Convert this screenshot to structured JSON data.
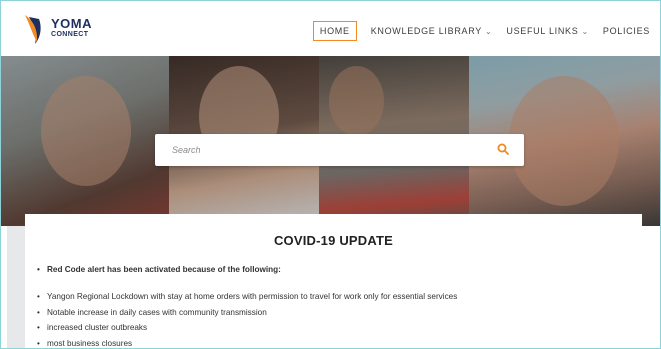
{
  "header": {
    "logo": {
      "word": "YOMA",
      "sub": "CONNECT",
      "colors": {
        "orange": "#f08a24",
        "navy": "#1d2f5f"
      }
    },
    "nav": [
      {
        "label": "HOME",
        "active": true,
        "dropdown": false
      },
      {
        "label": "KNOWLEDGE LIBRARY",
        "active": false,
        "dropdown": true
      },
      {
        "label": "USEFUL LINKS",
        "active": false,
        "dropdown": true
      },
      {
        "label": "POLICIES",
        "active": false,
        "dropdown": false
      }
    ]
  },
  "search": {
    "placeholder": "Search",
    "icon": "search-icon",
    "icon_color": "#f08a24"
  },
  "main": {
    "title": "COVID-19 UPDATE",
    "lead": "Red Code alert has been activated because of the following:",
    "items": [
      "Yangon Regional Lockdown with stay at home orders with permission to travel for work only for essential services",
      "Notable increase in daily cases with community transmission",
      "increased cluster outbreaks",
      "most business closures"
    ]
  },
  "colors": {
    "accent": "#f08a24",
    "border": "#8fd3da"
  }
}
